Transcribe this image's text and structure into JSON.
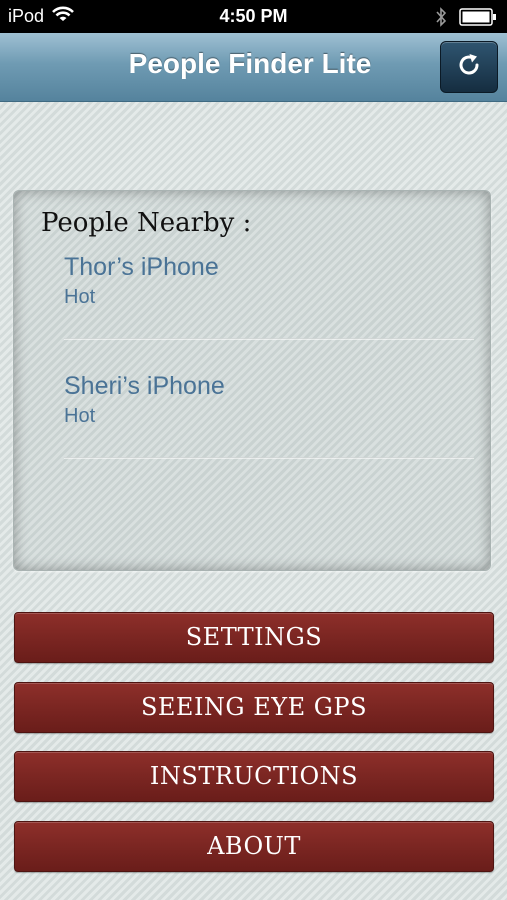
{
  "status_bar": {
    "carrier": "iPod",
    "time": "4:50 PM"
  },
  "nav": {
    "title": "People Finder Lite"
  },
  "panel": {
    "title": "People Nearby :",
    "devices": [
      {
        "name": "Thor’s iPhone",
        "status": "Hot"
      },
      {
        "name": "Sheri’s iPhone",
        "status": "Hot"
      }
    ]
  },
  "buttons": {
    "settings": "SETTINGS",
    "seeing_eye_gps": "SEEING EYE GPS",
    "instructions": "INSTRUCTIONS",
    "about": "ABOUT"
  },
  "icons": [
    "wifi-icon",
    "bluetooth-icon",
    "battery-icon",
    "refresh-icon"
  ],
  "colors": {
    "nav_bar": "#6f9bb3",
    "button": "#7b2622",
    "device_text": "#4a7396"
  }
}
